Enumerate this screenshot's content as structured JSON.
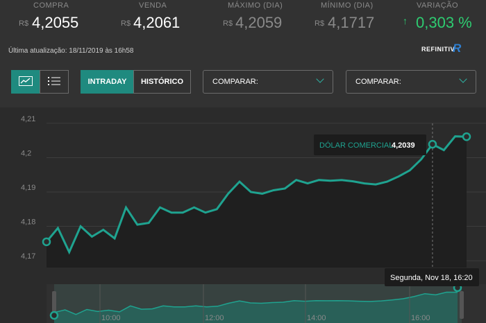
{
  "header": {
    "stats": [
      {
        "label": "COMPRA",
        "currency": "R$",
        "value": "4,2055"
      },
      {
        "label": "VENDA",
        "currency": "R$",
        "value": "4,2061"
      },
      {
        "label": "MÁXIMO (DIA)",
        "currency": "R$",
        "value": "4,2059"
      },
      {
        "label": "MÍNIMO (DIA)",
        "currency": "R$",
        "value": "4,1717"
      },
      {
        "label": "VARIAÇÃO",
        "arrow": "↑",
        "value": "0,303 %"
      }
    ],
    "updated": "Última atualização: 18/11/2019 às 16h58",
    "brand": "REFINITIV",
    "brand_mark": "R"
  },
  "toolbar": {
    "chart_icon": "line-chart-icon",
    "list_icon": "list-icon",
    "intraday_label": "INTRADAY",
    "historico_label": "HISTÓRICO",
    "compare1": "COMPARAR:",
    "compare2": "COMPARAR:"
  },
  "colors": {
    "accent": "#1fa390",
    "up": "#2ecc71",
    "background": "#2b2b2b"
  },
  "tooltip": {
    "series": "DÓLAR COMERCIAL",
    "value": "4,2039"
  },
  "date_tooltip": "Segunda, Nov 18, 16:20",
  "chart_data": {
    "type": "line",
    "yticks": [
      "4,21",
      "4,2",
      "4,19",
      "4,18",
      "4,17"
    ],
    "ylim": [
      4.168,
      4.212
    ],
    "xticks_navigator": [
      "10:00",
      "12:00",
      "14:00",
      "16:00"
    ],
    "x": [
      9.0,
      9.15,
      9.35,
      9.55,
      9.85,
      10.1,
      10.3,
      10.55,
      10.8,
      11.1,
      11.5,
      11.7,
      11.95,
      12.2,
      12.45,
      12.75,
      13.1,
      13.4,
      13.75,
      13.95,
      14.15,
      14.35,
      14.75,
      15.0,
      15.4,
      15.7,
      15.95,
      16.2,
      16.35,
      16.55,
      16.75,
      16.95
    ],
    "y": [
      4.1755,
      4.1795,
      4.1725,
      4.18,
      4.177,
      4.179,
      4.1765,
      4.1855,
      4.1805,
      4.181,
      4.1855,
      4.184,
      4.184,
      4.1855,
      4.184,
      4.185,
      4.1895,
      4.193,
      4.19,
      4.1895,
      4.1905,
      4.191,
      4.1935,
      4.1925,
      4.1935,
      4.1933,
      4.1935,
      4.1931,
      4.1925,
      4.1922,
      4.193,
      4.1945,
      4.1963,
      4.1995,
      4.2039,
      4.2022,
      4.2062,
      4.2061
    ],
    "highlight_index": 34
  }
}
